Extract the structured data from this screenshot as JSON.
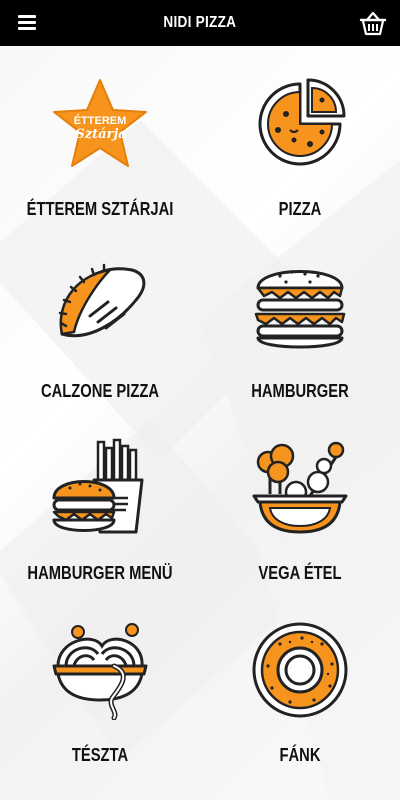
{
  "header": {
    "title": "NIDI PIZZA"
  },
  "logo": {
    "line1": "ÉTTEREM",
    "line2": "Sztárja"
  },
  "categories": [
    {
      "label": "ÉTTEREM SZTÁRJAI",
      "icon": "star-logo-icon"
    },
    {
      "label": "PIZZA",
      "icon": "pizza-icon"
    },
    {
      "label": "CALZONE PIZZA",
      "icon": "calzone-icon"
    },
    {
      "label": "HAMBURGER",
      "icon": "hamburger-icon"
    },
    {
      "label": "HAMBURGER MENÜ",
      "icon": "burger-fries-icon"
    },
    {
      "label": "VEGA ÉTEL",
      "icon": "vegetable-bowl-icon"
    },
    {
      "label": "TÉSZTA",
      "icon": "pasta-bowl-icon"
    },
    {
      "label": "FÁNK",
      "icon": "donut-icon"
    }
  ],
  "colors": {
    "accent": "#f7941d",
    "dark": "#2b2b2b",
    "header_bg": "#000000"
  }
}
